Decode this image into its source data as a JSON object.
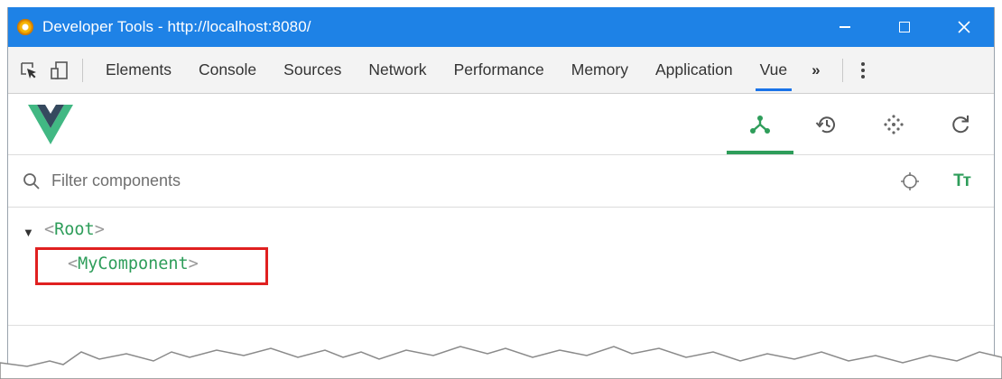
{
  "window": {
    "title": "Developer Tools - http://localhost:8080/",
    "controls": [
      "minimize",
      "maximize",
      "close"
    ]
  },
  "toolbar": {
    "tabs": [
      {
        "label": "Elements"
      },
      {
        "label": "Console"
      },
      {
        "label": "Sources"
      },
      {
        "label": "Network"
      },
      {
        "label": "Performance"
      },
      {
        "label": "Memory"
      },
      {
        "label": "Application"
      },
      {
        "label": "Vue"
      }
    ],
    "active_tab": "Vue",
    "more_label": "»"
  },
  "vue_panel": {
    "actions": [
      "components-icon",
      "history-icon",
      "events-icon",
      "refresh-icon"
    ],
    "active_action": "components-icon",
    "accent_color": "#2e9d5a",
    "filter": {
      "placeholder": "Filter components",
      "value": ""
    },
    "text_toggle_label": "Tт",
    "tree": {
      "root": "Root",
      "children": [
        "MyComponent"
      ]
    },
    "highlight_color": "#e02020"
  },
  "colors": {
    "titlebar": "#1e82e6",
    "vue_green": "#41b883",
    "vue_dark": "#35495e"
  }
}
